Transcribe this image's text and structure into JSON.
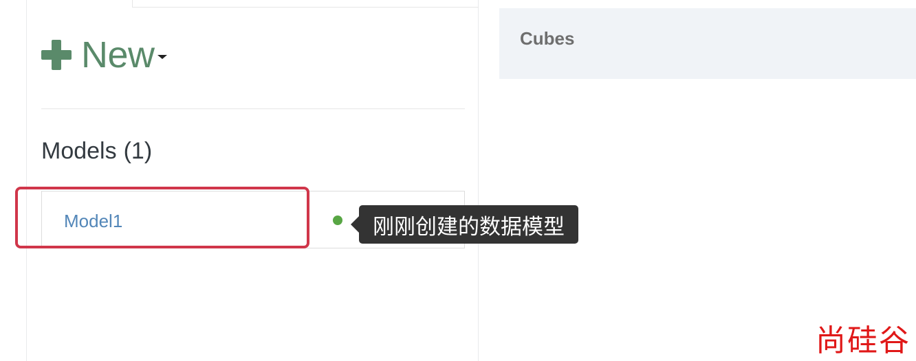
{
  "models_panel": {
    "new_button": {
      "label": "New",
      "icon": "plus-icon",
      "dropdown_icon": "caret-down-icon",
      "color": "#5a8a6a"
    },
    "heading": {
      "label": "Models",
      "count": "(1)"
    },
    "models": [
      {
        "name": "Model1",
        "status_color": "#58a644"
      }
    ]
  },
  "annotation": {
    "tooltip_text": "刚刚创建的数据模型",
    "highlight_color": "#d0364a"
  },
  "cubes_panel": {
    "title": "Cubes"
  },
  "watermark": {
    "text": "尚硅谷",
    "color": "#e01818"
  }
}
